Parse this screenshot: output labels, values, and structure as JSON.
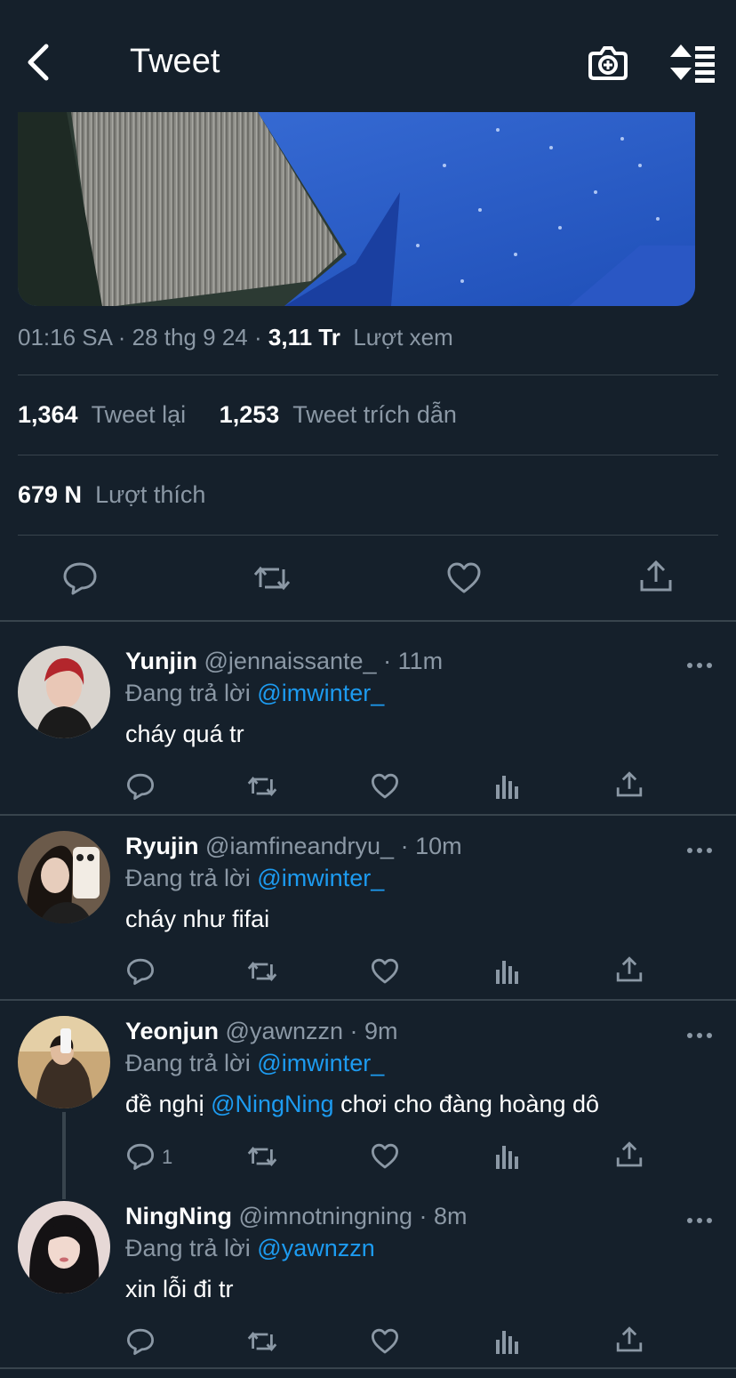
{
  "header": {
    "title": "Tweet",
    "back_icon": "back-chevron-icon",
    "camera_icon": "camera-plus-icon",
    "sort_icon": "sort-order-icon"
  },
  "tweet": {
    "time": "01:16 SA",
    "date": "28 thg 9 24",
    "views_count": "3,11 Tr",
    "views_label": "Lượt xem",
    "retweets_count": "1,364",
    "retweets_label": "Tweet lại",
    "quotes_count": "1,253",
    "quotes_label": "Tweet trích dẫn",
    "likes_count": "679 N",
    "likes_label": "Lượt thích"
  },
  "colors": {
    "background": "#15202b",
    "divider": "#38444d",
    "muted": "#8b98a5",
    "link": "#1d9bf0"
  },
  "replies": [
    {
      "name": "Yunjin",
      "handle": "@jennaissante_",
      "time": "11m",
      "replying_label": "Đang trả lời",
      "replying_to": "@imwinter_",
      "text": "cháy quá tr",
      "reply_count": ""
    },
    {
      "name": "Ryujin",
      "handle": "@iamfineandryu_",
      "time": "10m",
      "replying_label": "Đang trả lời",
      "replying_to": "@imwinter_",
      "text": "cháy như fifai",
      "reply_count": ""
    },
    {
      "name": "Yeonjun",
      "handle": "@yawnzzn",
      "time": "9m",
      "replying_label": "Đang trả lời",
      "replying_to": "@imwinter_",
      "text_before": "đề nghị",
      "text_mention": "@NingNing",
      "text_after": "chơi cho đàng hoàng dô",
      "reply_count": "1"
    },
    {
      "name": "NingNing",
      "handle": "@imnotningning",
      "time": "8m",
      "replying_label": "Đang trả lời",
      "replying_to": "@yawnzzn",
      "text": "xin lỗi đi tr",
      "reply_count": ""
    }
  ]
}
